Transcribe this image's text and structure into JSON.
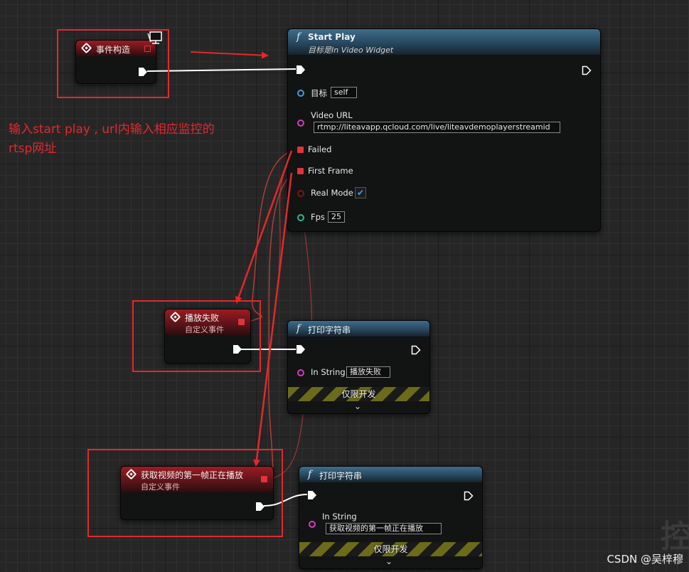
{
  "annotation": {
    "line1": "输入start play ,   url内输入相应监控的",
    "line2": "rtsp网址"
  },
  "nodes": {
    "event_construct": {
      "title": "事件构造"
    },
    "start_play": {
      "title": "Start Play",
      "subtitle": "目标是In Video Widget",
      "pins": {
        "target_label": "目标",
        "target_value": "self",
        "url_label": "Video URL",
        "url_value": "rtmp://liteavapp.qcloud.com/live/liteavdemoplayerstreamid",
        "failed_label": "Failed",
        "first_frame_label": "First Frame",
        "real_mode_label": "Real Mode",
        "real_mode_checked": "✔",
        "fps_label": "Fps",
        "fps_value": "25"
      }
    },
    "play_failed_event": {
      "title": "播放失败",
      "subtitle": "自定义事件"
    },
    "print_string_1": {
      "title": "打印字符串",
      "in_string_label": "In String",
      "in_string_value": "播放失败",
      "dev_only": "仅限开发"
    },
    "first_frame_event": {
      "title": "获取视频的第一帧正在播放",
      "subtitle": "自定义事件"
    },
    "print_string_2": {
      "title": "打印字符串",
      "in_string_label": "In String",
      "in_string_value": "获取视频的第一帧正在播放",
      "dev_only": "仅限开发"
    }
  },
  "ghost_char": "控",
  "watermark": "CSDN @吴梓穆",
  "colors": {
    "exec_wire": "#ffffff",
    "delegate_wire": "#c94343",
    "annotation_red": "#e3282c",
    "event_header": "#8f1b20",
    "function_header": "#3a6584"
  }
}
